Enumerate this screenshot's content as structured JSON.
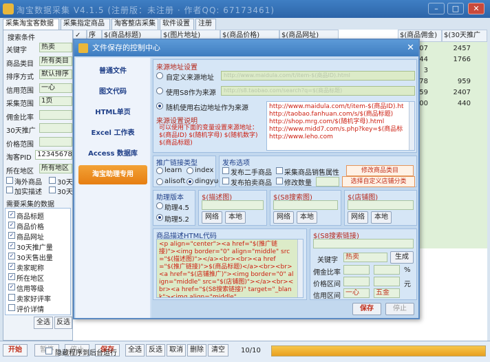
{
  "window": {
    "title": "淘宝数据采集 V4.1.5 (注册版：未注册 · 作者QQ: 67173461)",
    "min": "–",
    "max": "□",
    "close": "✕"
  },
  "tabs": [
    "采集淘宝客数据",
    "采集指定商品",
    "淘客整店采集",
    "软件设置",
    "注册"
  ],
  "left": {
    "section_title": "搜索条件",
    "fields": [
      {
        "label": "关键字",
        "value": "热卖"
      },
      {
        "label": "商品类目",
        "value": "所有类目"
      },
      {
        "label": "排序方式",
        "value": "默认排序"
      },
      {
        "label": "信用范围",
        "value": "一心"
      },
      {
        "label": "采集范围",
        "value": "1页"
      },
      {
        "label": "佣金比率",
        "value": ""
      },
      {
        "label": "30天推广",
        "value": ""
      },
      {
        "label": "价格范围",
        "value": ""
      },
      {
        "label": "淘客PID",
        "value": "12345678"
      },
      {
        "label": "所在地区",
        "value": "所有地区"
      }
    ],
    "checks": [
      {
        "label": "海外商品",
        "checked": false
      },
      {
        "label": "30天",
        "checked": false
      },
      {
        "label": "加实描述",
        "checked": false
      },
      {
        "label": "30天",
        "checked": false
      }
    ],
    "data_title": "需要采集的数据",
    "data_items": [
      "商品标题",
      "商品价格",
      "商品网址",
      "30天推广量",
      "30天售出量",
      "卖家昵称",
      "所在地区",
      "信用等级",
      "卖家好评率",
      "评价详情"
    ],
    "select_all": "全选",
    "invert": "反选"
  },
  "grid": {
    "headers": [
      "✓",
      "序",
      "$(商品标题)",
      "$(图片地址)",
      "$(商品价格)",
      "$(商品网址)",
      "$(商品佣金)",
      "$(30天推广"
    ],
    "rows": [
      {
        "a": "07",
        "b": "2457"
      },
      {
        "a": "44",
        "b": "1766"
      },
      {
        "a": "3",
        "b": ""
      },
      {
        "a": "78",
        "b": "959"
      },
      {
        "a": "59",
        "b": "2407"
      },
      {
        "a": "00",
        "b": "440"
      }
    ]
  },
  "dialog": {
    "title": "文件保存的控制中心",
    "close": "✕",
    "nav": [
      "普通文件",
      "图文代码",
      "HTML单页",
      "Excel 工作表",
      "Access 数据库",
      "淘宝助理专用"
    ],
    "url_group": {
      "title": "来源地址设置",
      "options": [
        {
          "label": "自定义来源地址",
          "checked": false,
          "value": "http://www.maidula.com/t/item-$(商品ID).html"
        },
        {
          "label": "使用S8作为来源",
          "checked": false,
          "value": "http://s8.taobao.com/search?q=$(商品标题)"
        },
        {
          "label": "随机使用右边地址作为来源",
          "checked": true
        }
      ],
      "random_urls": [
        "http://www.maidula.com/t/item-$(商品ID).ht",
        "http://taobao.fanhuan.com/s/$(商品标题)",
        "http://shop.mrg.com/$(随机字母).html",
        "http://www.midd7.com/s.php?key=$(商品标",
        "http://www.leho.com"
      ],
      "note_title": "来源设置说明",
      "note_text": "可以使用下面的变量设置来源地址：$(商品ID) $(随机字母) $(随机数字) $(商品标题)"
    },
    "link_group": {
      "title": "推广链接类型",
      "options": [
        {
          "label": "learn",
          "checked": false
        },
        {
          "label": "index",
          "checked": false
        },
        {
          "label": "alisoft",
          "checked": false
        },
        {
          "label": "dingyue",
          "checked": true
        }
      ]
    },
    "pub_group": {
      "title": "发布选项",
      "checks": [
        "发布二手商品",
        "采集商品销售属性",
        "发布拍卖商品",
        "修改数量"
      ],
      "btn_category": "修改商品类目",
      "btn_category_custom": "选择自定义店铺分类"
    },
    "helper_group": {
      "title": "助理版本",
      "options": [
        {
          "label": "助理4.5",
          "checked": false
        },
        {
          "label": "助理5.2",
          "checked": true
        }
      ]
    },
    "desc_img": {
      "title": "$(描述图)",
      "btn_net": "网络",
      "btn_local": "本地"
    },
    "s8_img": {
      "title": "$(S8搜索图)",
      "btn_net": "网络",
      "btn_local": "本地"
    },
    "shop_img": {
      "title": "$(店铺图)",
      "btn_net": "网络",
      "btn_local": "本地"
    },
    "html_group": {
      "title": "商品描述HTML代码",
      "code": "<p align=\"center\"><a href=\"$(推广链接)\"><img border=\"0\" align=\"middle\" src=\"$(描述图)\"></a><br><br><a href=\"$(推广链接)\">$(商品标题)</a><br><br><a href=\"$(店铺推广)\"><img border=\"0\" align=\"middle\" src=\"$(店铺图)\"></a><br><br><a href=\"$(S8搜索链接)\" target=\"_blank\"><img align=\"middle\""
    },
    "s8_link": {
      "title": "$(S8搜索链接)",
      "keyword_label": "关键字",
      "keyword": "热卖",
      "generate": "生成",
      "commission": "佣金比率",
      "percent": "%",
      "price": "价格区间",
      "yuan": "元",
      "credit": "信用区间",
      "credit_from": "一心",
      "credit_to": "五金"
    },
    "save": "保存",
    "stop": "停止"
  },
  "bottom": {
    "start": "开始",
    "pause": "暂停",
    "stop": "停止",
    "save": "保存",
    "hide_bg": "隐藏程序到后台运行",
    "select_all": "全选",
    "invert": "反选",
    "cancel": "取消",
    "delete": "删除",
    "clear": "清空",
    "progress_text": "10/10",
    "progress": 1.0
  }
}
